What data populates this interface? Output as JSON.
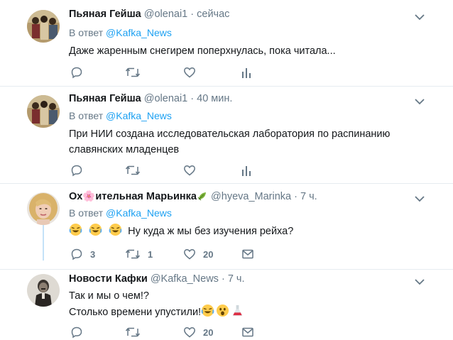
{
  "tweets": [
    {
      "name": "Пьяная Гейша",
      "handle": "@olenai1",
      "time": "· сейчас",
      "reply_prefix": "В ответ",
      "reply_to": "@Kafka_News",
      "text_lines": [
        "Даже жаренным снегирем поперхнулась, пока читала..."
      ],
      "counts": {
        "reply": "",
        "retweet": "",
        "like": ""
      }
    },
    {
      "name": "Пьяная Гейша",
      "handle": "@olenai1",
      "time": "· 40 мин.",
      "reply_prefix": "В ответ",
      "reply_to": "@Kafka_News",
      "text_lines": [
        "При НИИ создана исследовательская лаборатория по распинанию",
        "славянских младенцев"
      ],
      "counts": {
        "reply": "",
        "retweet": "",
        "like": ""
      }
    },
    {
      "name": "Ох🌸ительная Марьинка",
      "handle": "@hyeva_Marinka",
      "time": "· 7 ч.",
      "reply_prefix": "В ответ",
      "reply_to": "@Kafka_News",
      "text_lines": [
        "Ну куда ж мы без изучения рейха?"
      ],
      "counts": {
        "reply": "3",
        "retweet": "1",
        "like": "20"
      }
    },
    {
      "name": "Новости Кафки",
      "handle": "@Kafka_News",
      "time": "· 7 ч.",
      "text_lines": [
        "Так и мы о чем!?",
        "Столько времени упустили!"
      ],
      "counts": {
        "reply": "",
        "retweet": "",
        "like": "20"
      }
    }
  ],
  "icons": {
    "reply": "reply-icon",
    "retweet": "retweet-icon",
    "like": "heart-icon",
    "analytics": "analytics-icon",
    "dm": "direct-message-icon",
    "caret": "chevron-down-icon"
  },
  "colors": {
    "link": "#1da1f2",
    "meta": "#657786",
    "divider": "#e6ecf0",
    "thread": "#c4e2f8"
  }
}
